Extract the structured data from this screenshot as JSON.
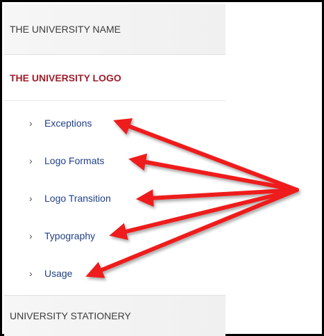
{
  "nav": {
    "sections": {
      "university_name": "THE UNIVERSITY NAME",
      "university_logo": "THE UNIVERSITY LOGO",
      "university_stationery": "UNIVERSITY STATIONERY"
    },
    "logo_items": [
      {
        "label": "Exceptions",
        "chevron": "›"
      },
      {
        "label": "Logo Formats",
        "chevron": "›"
      },
      {
        "label": "Logo Transition",
        "chevron": "›"
      },
      {
        "label": "Typography",
        "chevron": "›"
      },
      {
        "label": "Usage",
        "chevron": "›"
      }
    ]
  },
  "annotation": {
    "arrow_color": "#ee1c1c"
  }
}
